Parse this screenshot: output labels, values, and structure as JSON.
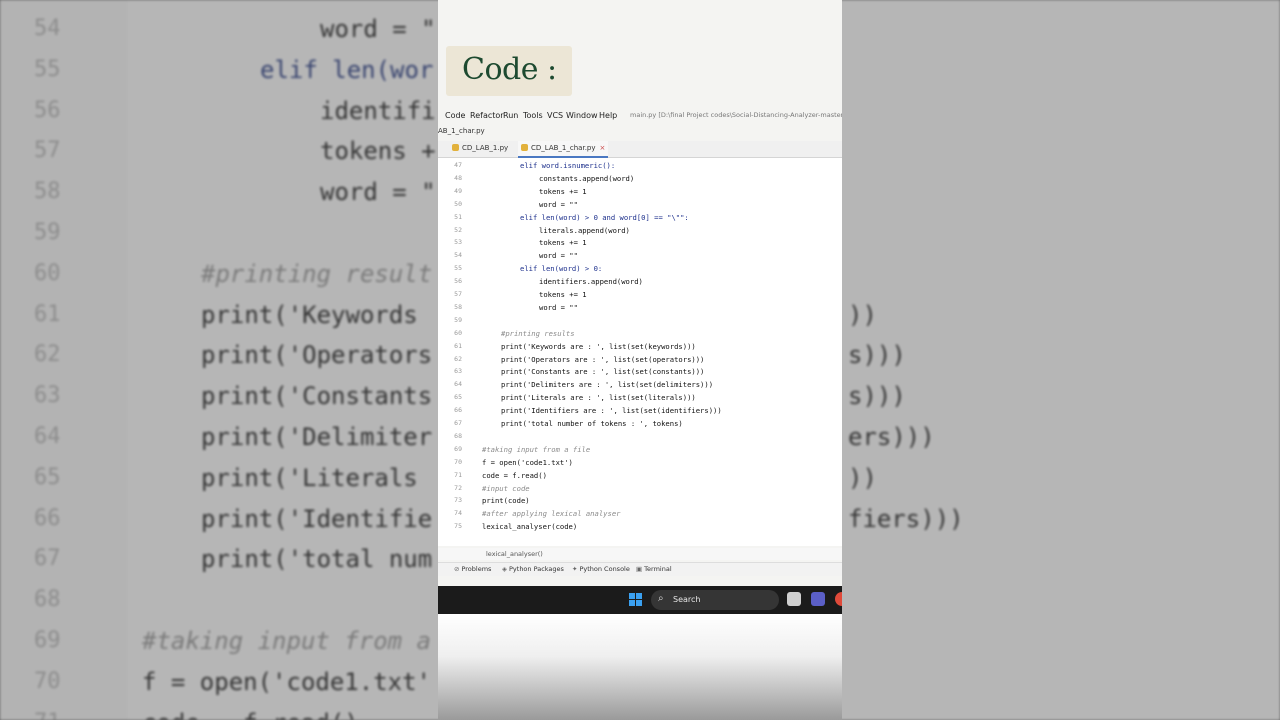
{
  "title_card": {
    "text": "Code :"
  },
  "menu": {
    "items": [
      "Code",
      "Refactor",
      "Run",
      "Tools",
      "VCS",
      "Window",
      "Help"
    ],
    "path": "main.py [D:\\final Project codes\\Social-Distancing-Analyzer-master] -"
  },
  "project_label": "AB_1_char.py",
  "tabs": [
    {
      "label": "CD_LAB_1.py",
      "active": false
    },
    {
      "label": "CD_LAB_1_char.py",
      "active": true
    }
  ],
  "code_lines": [
    {
      "num": "47",
      "indent": 2,
      "text": "elif word.isnumeric():",
      "kind": "kw"
    },
    {
      "num": "48",
      "indent": 3,
      "text": "constants.append(word)",
      "kind": "plain"
    },
    {
      "num": "49",
      "indent": 3,
      "text": "tokens += 1",
      "kind": "plain"
    },
    {
      "num": "50",
      "indent": 3,
      "text": "word = \"\"",
      "kind": "plain"
    },
    {
      "num": "51",
      "indent": 2,
      "text": "elif len(word) > 0 and word[0] == \"\\\"\":",
      "kind": "kw"
    },
    {
      "num": "52",
      "indent": 3,
      "text": "literals.append(word)",
      "kind": "plain"
    },
    {
      "num": "53",
      "indent": 3,
      "text": "tokens += 1",
      "kind": "plain"
    },
    {
      "num": "54",
      "indent": 3,
      "text": "word = \"\"",
      "kind": "plain"
    },
    {
      "num": "55",
      "indent": 2,
      "text": "elif len(word) > 0:",
      "kind": "kw"
    },
    {
      "num": "56",
      "indent": 3,
      "text": "identifiers.append(word)",
      "kind": "plain"
    },
    {
      "num": "57",
      "indent": 3,
      "text": "tokens += 1",
      "kind": "plain"
    },
    {
      "num": "58",
      "indent": 3,
      "text": "word = \"\"",
      "kind": "plain"
    },
    {
      "num": "59",
      "indent": 0,
      "text": "",
      "kind": "plain"
    },
    {
      "num": "60",
      "indent": 1,
      "text": "#printing results",
      "kind": "cm"
    },
    {
      "num": "61",
      "indent": 1,
      "text": "print('Keywords are : ', list(set(keywords)))",
      "kind": "plain"
    },
    {
      "num": "62",
      "indent": 1,
      "text": "print('Operators are : ', list(set(operators)))",
      "kind": "plain"
    },
    {
      "num": "63",
      "indent": 1,
      "text": "print('Constants are : ', list(set(constants)))",
      "kind": "plain"
    },
    {
      "num": "64",
      "indent": 1,
      "text": "print('Delimiters are : ', list(set(delimiters)))",
      "kind": "plain"
    },
    {
      "num": "65",
      "indent": 1,
      "text": "print('Literals are : ', list(set(literals)))",
      "kind": "plain"
    },
    {
      "num": "66",
      "indent": 1,
      "text": "print('Identifiers are : ', list(set(identifiers)))",
      "kind": "plain"
    },
    {
      "num": "67",
      "indent": 1,
      "text": "print('total number of tokens : ', tokens)",
      "kind": "plain"
    },
    {
      "num": "68",
      "indent": 0,
      "text": "",
      "kind": "plain"
    },
    {
      "num": "69",
      "indent": 0,
      "text": "#taking input from a file",
      "kind": "cm"
    },
    {
      "num": "70",
      "indent": 0,
      "text": "f = open('code1.txt')",
      "kind": "plain"
    },
    {
      "num": "71",
      "indent": 0,
      "text": "code = f.read()",
      "kind": "plain"
    },
    {
      "num": "72",
      "indent": 0,
      "text": "#input code",
      "kind": "cm"
    },
    {
      "num": "73",
      "indent": 0,
      "text": "print(code)",
      "kind": "plain"
    },
    {
      "num": "74",
      "indent": 0,
      "text": "#after applying lexical analyser",
      "kind": "cm"
    },
    {
      "num": "75",
      "indent": 0,
      "text": "lexical_analyser(code)",
      "kind": "plain"
    }
  ],
  "breadcrumb": "lexical_analyser()",
  "tool_windows": [
    "Problems",
    "Python Packages",
    "Python Console",
    "Terminal"
  ],
  "taskbar": {
    "search_label": "Search"
  },
  "background": {
    "lines": [
      {
        "num": "54",
        "text": "word = \"",
        "x": "indent3",
        "kind": "plain",
        "right": ""
      },
      {
        "num": "55",
        "text": "elif len(wor",
        "x": "indent2",
        "kind": "kw",
        "right": ""
      },
      {
        "num": "56",
        "text": "identifi",
        "x": "indent3",
        "kind": "plain",
        "right": ""
      },
      {
        "num": "57",
        "text": "tokens +",
        "x": "indent3",
        "kind": "plain",
        "right": ""
      },
      {
        "num": "58",
        "text": "word = \"",
        "x": "indent3",
        "kind": "plain",
        "right": ""
      },
      {
        "num": "59",
        "text": "",
        "x": "indent1",
        "kind": "plain",
        "right": ""
      },
      {
        "num": "60",
        "text": "#printing result",
        "x": "indent1",
        "kind": "cm",
        "right": ""
      },
      {
        "num": "61",
        "text": "print('Keywords",
        "x": "indent1",
        "kind": "plain",
        "right": "))"
      },
      {
        "num": "62",
        "text": "print('Operators",
        "x": "indent1",
        "kind": "plain",
        "right": "s)))"
      },
      {
        "num": "63",
        "text": "print('Constants",
        "x": "indent1",
        "kind": "plain",
        "right": "s)))"
      },
      {
        "num": "64",
        "text": "print('Delimiter",
        "x": "indent1",
        "kind": "plain",
        "right": "ers)))"
      },
      {
        "num": "65",
        "text": "print('Literals",
        "x": "indent1",
        "kind": "plain",
        "right": "))"
      },
      {
        "num": "66",
        "text": "print('Identifie",
        "x": "indent1",
        "kind": "plain",
        "right": "fiers)))"
      },
      {
        "num": "67",
        "text": "print('total num",
        "x": "indent1",
        "kind": "plain",
        "right": ""
      },
      {
        "num": "68",
        "text": "",
        "x": "indent0",
        "kind": "plain",
        "right": ""
      },
      {
        "num": "69",
        "text": "#taking input from a",
        "x": "indent0",
        "kind": "cm",
        "right": ""
      },
      {
        "num": "70",
        "text": "f = open('code1.txt'",
        "x": "indent0",
        "kind": "plain",
        "right": ""
      },
      {
        "num": "71",
        "text": "code = f.read()",
        "x": "indent0",
        "kind": "plain",
        "right": ""
      }
    ]
  }
}
